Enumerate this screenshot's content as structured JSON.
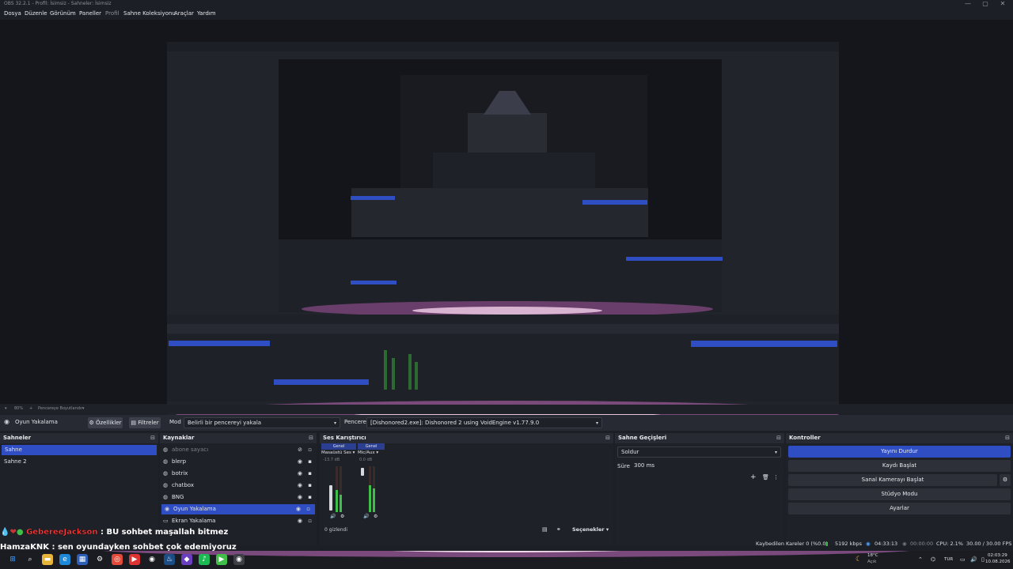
{
  "window": {
    "title": "OBS 32.2.1 - Profil: İsimsiz - Sahneler: İsimsiz",
    "controls": [
      "—",
      "▢",
      "✕"
    ]
  },
  "menu": [
    {
      "label": "Dosya"
    },
    {
      "label": "Düzenle"
    },
    {
      "label": "Görünüm"
    },
    {
      "label": "Paneller"
    },
    {
      "label": "Profil",
      "dim": true
    },
    {
      "label": "Sahne Koleksiyonu"
    },
    {
      "label": "Araçlar"
    },
    {
      "label": "Yardım"
    }
  ],
  "zoom_bar": {
    "zoom": "80%",
    "plus": "+",
    "mode": "Pencereye Boyutlandır",
    "caret": "▾"
  },
  "context_bar": {
    "source_name": "Oyun Yakalama",
    "properties_label": "Özellikler",
    "filters_label": "Filtreler",
    "mode_label": "Mod",
    "mode_value": "Belirli bir pencereyi yakala",
    "window_label": "Pencere",
    "window_value": "[Dishonored2.exe]: Dishonored 2 using VoidEngine v1.77.9.0"
  },
  "scenes": {
    "title": "Sahneler",
    "items": [
      {
        "label": "Sahne",
        "selected": true
      },
      {
        "label": "Sahne 2",
        "selected": false
      }
    ]
  },
  "sources": {
    "title": "Kaynaklar",
    "items": [
      {
        "label": "abone sayacı",
        "icon": "browser-icon",
        "hidden": true,
        "locked": false
      },
      {
        "label": "blerp",
        "icon": "browser-icon",
        "hidden": false,
        "locked": true
      },
      {
        "label": "botrix",
        "icon": "browser-icon",
        "hidden": false,
        "locked": true
      },
      {
        "label": "chatbox",
        "icon": "browser-icon",
        "hidden": false,
        "locked": true
      },
      {
        "label": "BNG",
        "icon": "browser-icon",
        "hidden": false,
        "locked": true
      },
      {
        "label": "Oyun Yakalama",
        "icon": "gamepad-icon",
        "hidden": false,
        "locked": false,
        "selected": true
      },
      {
        "label": "Ekran Yakalama",
        "icon": "monitor-icon",
        "hidden": false,
        "locked": false
      }
    ]
  },
  "mixer": {
    "title": "Ses Karıştırıcı",
    "channels": [
      {
        "tag": "Genel",
        "name": "Masaüstü Ses",
        "db": "-13.7 dB"
      },
      {
        "tag": "Genel",
        "name": "Mic/Aux",
        "db": "0.0 dB"
      }
    ],
    "scale": [
      "0",
      "-5",
      "-10",
      "-15",
      "-20",
      "-25",
      "-30",
      "-35",
      "-40",
      "-45",
      "-50",
      "-55",
      "-60"
    ],
    "hidden_count": "0 gizlendi",
    "options_label": "Seçenekler"
  },
  "transitions": {
    "title": "Sahne Geçişleri",
    "type": "Soldur",
    "duration_label": "Süre",
    "duration_value": "300 ms"
  },
  "controls": {
    "title": "Kontroller",
    "buttons": [
      {
        "label": "Yayını Durdur",
        "active": true
      },
      {
        "label": "Kaydı Başlat",
        "active": false
      },
      {
        "label": "Sanal Kamerayı Başlat",
        "active": false
      },
      {
        "label": "Stüdyo Modu",
        "active": false
      },
      {
        "label": "Ayarlar",
        "active": false
      }
    ]
  },
  "chat": [
    {
      "user": "GebereeJackson",
      "message": " : BU sohbet maşallah bitmez",
      "user_color": "#ff3b3b"
    },
    {
      "user": "HamzaKNK",
      "message": " : sen oyundayken sohbet çok edemiyoruz",
      "user_color": "#ffffff"
    }
  ],
  "status": {
    "dropped": "Kaybedilen Kareler 0 (%0.0)",
    "bitrate": "5192 kbps",
    "stream_time": "04:33:13",
    "rec_time": "00:00:00",
    "cpu": "CPU: 2.1%",
    "fps": "30.00 / 30.00 FPS"
  },
  "taskbar": {
    "weather_temp": "18°C",
    "weather_desc": "Açık",
    "lang": "TUR",
    "time": "02:03:29",
    "date": "10.08.2026"
  },
  "colors": {
    "accent": "#2f4ec4",
    "bg": "#1d1f26",
    "meter_green": "#3fbf4a"
  }
}
